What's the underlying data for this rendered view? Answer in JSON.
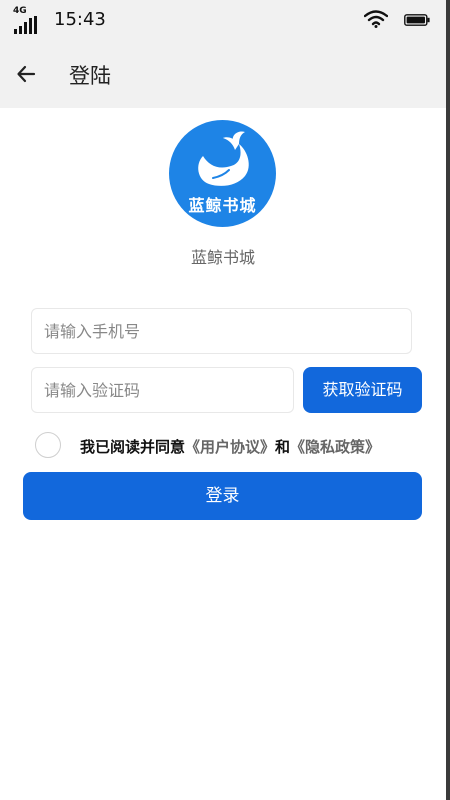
{
  "status_bar": {
    "network": "4G",
    "time": "15:43",
    "icons": [
      "signal-icon",
      "wifi-icon",
      "battery-icon"
    ]
  },
  "header": {
    "title": "登陆",
    "back_icon": "arrow-left-icon"
  },
  "logo": {
    "text": "蓝鲸书城",
    "icon": "whale-icon",
    "bg_color": "#1e84e6"
  },
  "app_name": "蓝鲸书城",
  "form": {
    "phone": {
      "value": "",
      "placeholder": "请输入手机号"
    },
    "code": {
      "value": "",
      "placeholder": "请输入验证码"
    },
    "get_code_label": "获取验证码",
    "agreement": {
      "checked": false,
      "prefix": "我已阅读并同意",
      "user_agreement": "《用户协议》",
      "conjunction": "和",
      "privacy_policy": "《隐私政策》"
    },
    "login_label": "登录"
  },
  "colors": {
    "primary": "#1268dc",
    "header_bg": "#f1f1f1"
  }
}
